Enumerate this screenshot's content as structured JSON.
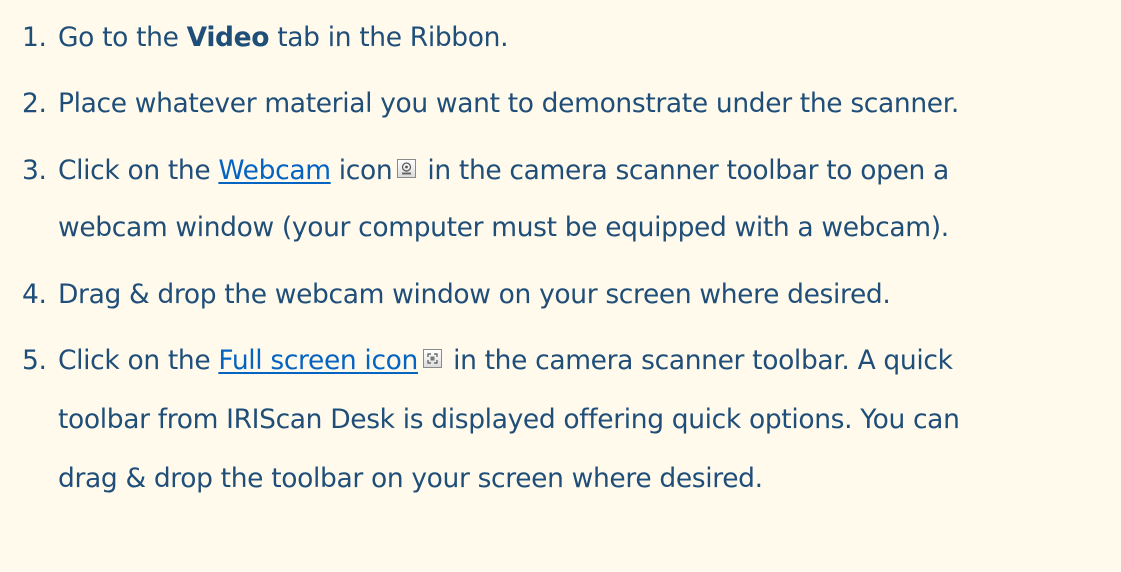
{
  "steps": [
    {
      "number": "1.",
      "text_before": "Go to the",
      "bold": "Video",
      "text_after": "tab in the Ribbon."
    },
    {
      "number": "2.",
      "text": "Place whatever material you want to demonstrate under the scanner."
    },
    {
      "number": "3.",
      "text_before": "Click on the",
      "link": "Webcam",
      "text_mid": "icon",
      "icon": "webcam-icon",
      "text_after": "in the camera scanner toolbar to open a",
      "continuation": "webcam window (your computer must be equipped with a webcam)."
    },
    {
      "number": "4.",
      "text": "Drag & drop the webcam window on your screen where desired."
    },
    {
      "number": "5.",
      "text_before": "Click on the",
      "link": "Full screen icon",
      "icon": "full-screen-icon",
      "text_after": "in the camera scanner toolbar. A quick",
      "continuation_1": "toolbar from IRIScan Desk is displayed offering quick options. You can",
      "continuation_2": "drag & drop the toolbar on your screen where desired."
    }
  ],
  "colors": {
    "background": "#FFFAEC",
    "text": "#1F4E79",
    "link": "#0563C1"
  }
}
